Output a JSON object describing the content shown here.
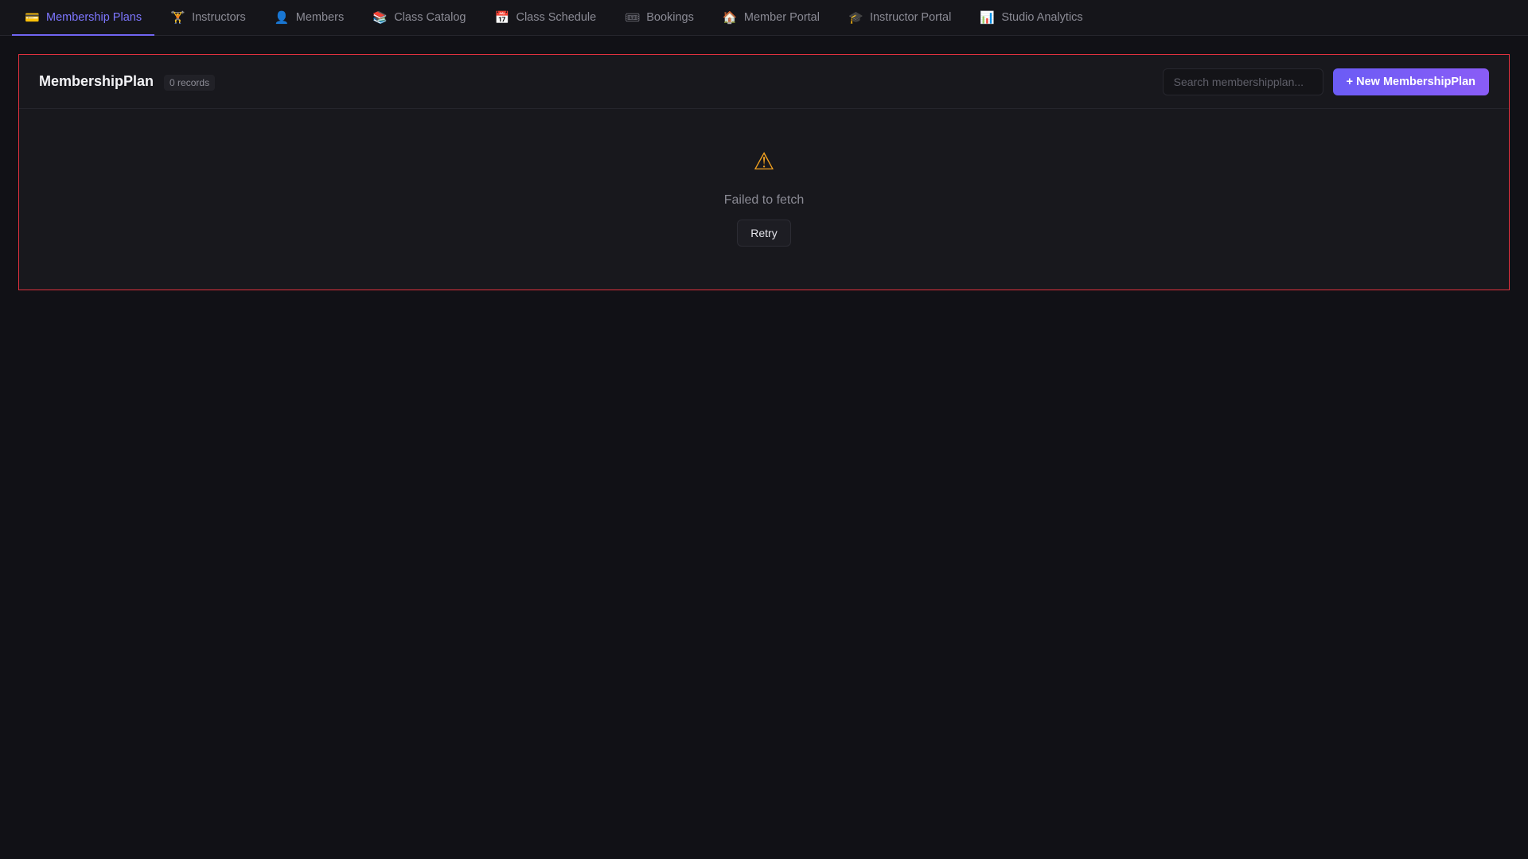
{
  "nav": {
    "tabs": [
      {
        "label": "Membership Plans",
        "icon": "💳",
        "icon_name": "credit-card-icon",
        "active": true
      },
      {
        "label": "Instructors",
        "icon": "🏋",
        "icon_name": "weightlifter-icon",
        "active": false
      },
      {
        "label": "Members",
        "icon": "👤",
        "icon_name": "person-icon",
        "active": false
      },
      {
        "label": "Class Catalog",
        "icon": "📚",
        "icon_name": "books-icon",
        "active": false
      },
      {
        "label": "Class Schedule",
        "icon": "📅",
        "icon_name": "calendar-icon",
        "active": false
      },
      {
        "label": "Bookings",
        "icon": "🎟",
        "icon_name": "ticket-icon",
        "active": false
      },
      {
        "label": "Member Portal",
        "icon": "🏠",
        "icon_name": "house-icon",
        "active": false
      },
      {
        "label": "Instructor Portal",
        "icon": "🎓",
        "icon_name": "graduation-cap-icon",
        "active": false
      },
      {
        "label": "Studio Analytics",
        "icon": "📊",
        "icon_name": "bar-chart-icon",
        "active": false
      }
    ]
  },
  "panel": {
    "title": "MembershipPlan",
    "records_badge": "0 records",
    "search_placeholder": "Search membershipplan...",
    "new_button_label": "+ New MembershipPlan",
    "error": {
      "icon": "⚠",
      "icon_name": "warning-icon",
      "message": "Failed to fetch",
      "retry_label": "Retry"
    }
  },
  "colors": {
    "accent": "#7165f2",
    "error_border": "#e0313e",
    "warning": "#f0a020",
    "background": "#111116"
  }
}
